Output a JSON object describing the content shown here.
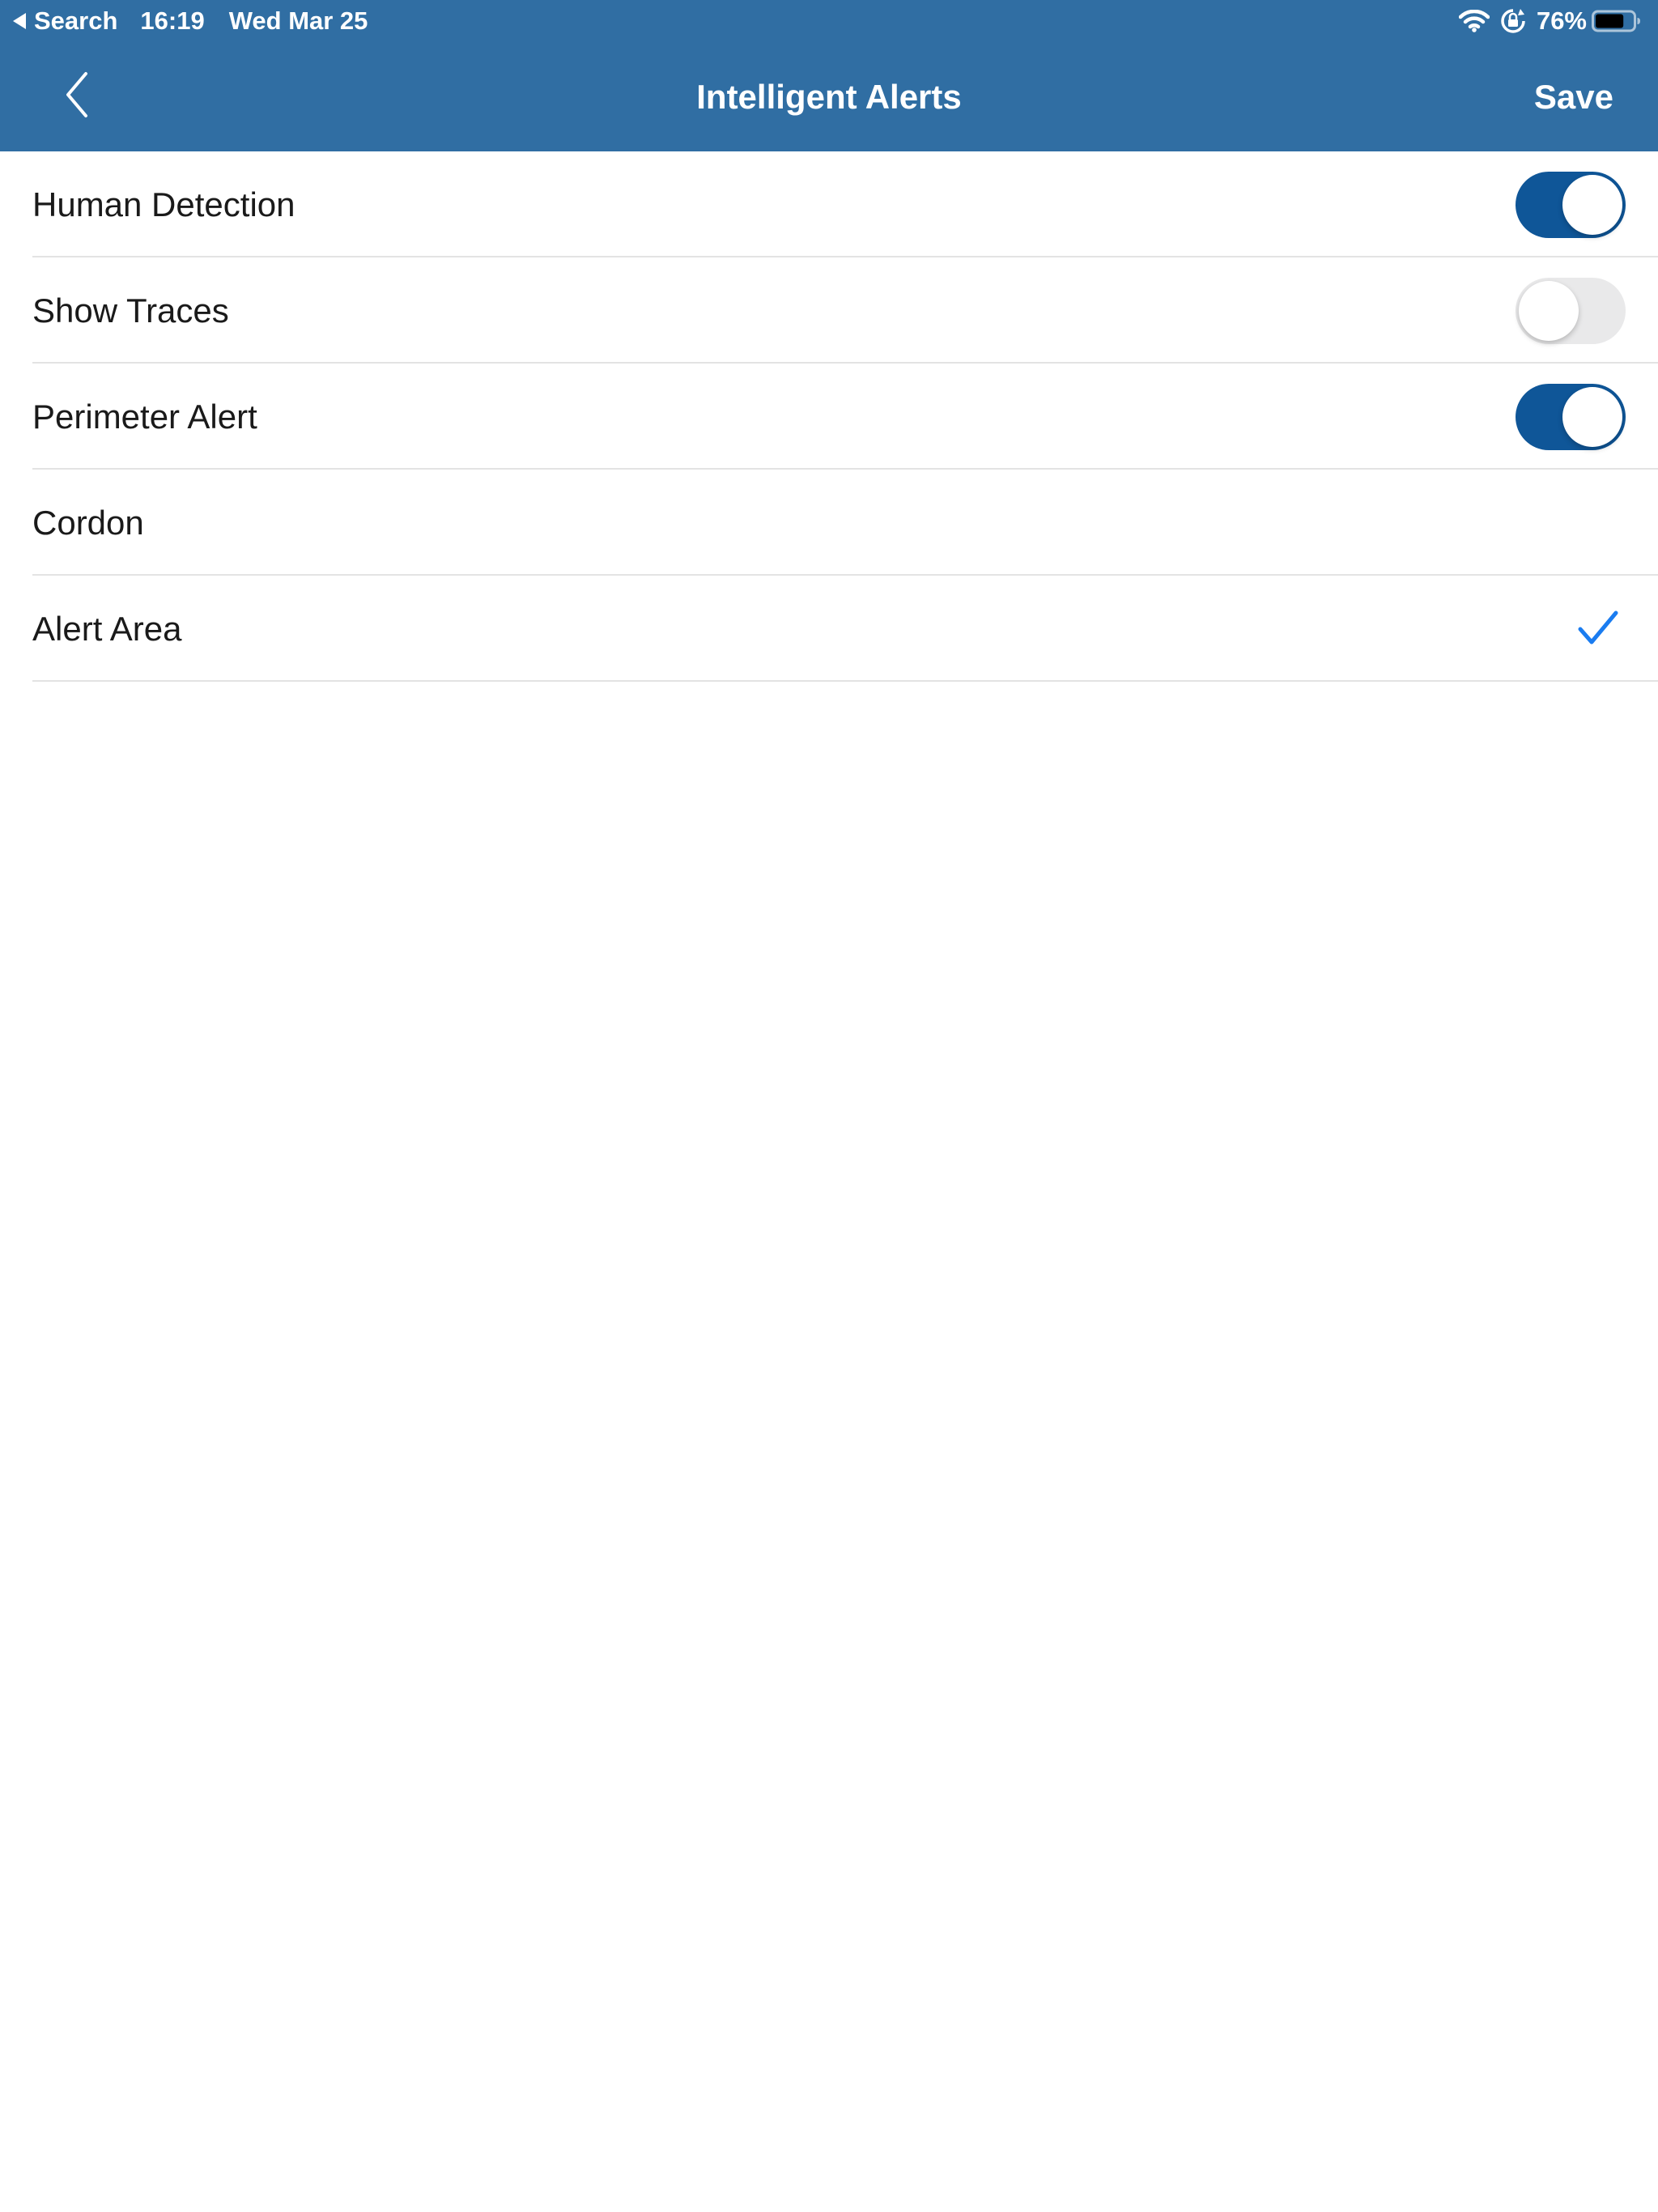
{
  "status_bar": {
    "back_app": "Search",
    "time": "16:19",
    "date": "Wed Mar 25",
    "icons": [
      "wifi-icon",
      "orientation-lock-icon",
      "battery-icon"
    ],
    "battery_percent": "76%",
    "battery_level": 0.76
  },
  "nav": {
    "back_icon": "chevron-left-icon",
    "title": "Intelligent Alerts",
    "save_label": "Save"
  },
  "list": {
    "items": [
      {
        "label": "Human Detection",
        "control": "toggle",
        "on": true
      },
      {
        "label": "Show Traces",
        "control": "toggle",
        "on": false
      },
      {
        "label": "Perimeter Alert",
        "control": "toggle",
        "on": true
      },
      {
        "label": "Cordon",
        "control": "none",
        "selected": false
      },
      {
        "label": "Alert Area",
        "control": "checkmark",
        "selected": true
      }
    ]
  },
  "colors": {
    "header_bg": "#306ea3",
    "toggle_on": "#0f5698",
    "toggle_off": "#e9e9ea",
    "checkmark": "#1a7cf0",
    "separator": "#e3e3e3"
  }
}
